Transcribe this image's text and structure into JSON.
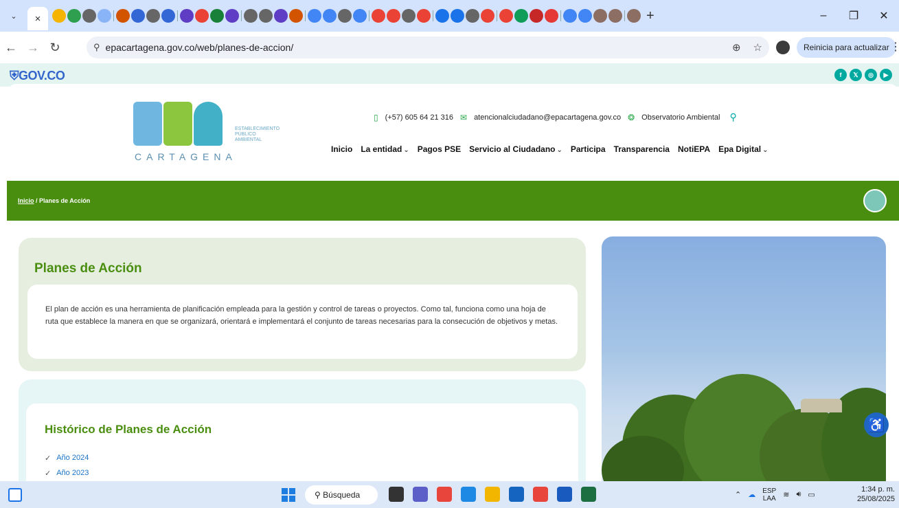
{
  "browser": {
    "url": "epacartagena.gov.co/web/planes-de-accion/",
    "update_button": "Reinicia para actualizar",
    "new_tab": "+",
    "tab_colors": [
      "#f4b400",
      "#2e9e4f",
      "#666666",
      "#8ab4f8",
      "#d35400",
      "#3367d6",
      "#666666",
      "#3367d6",
      "#5f3dc4",
      "#ea4335",
      "#188038",
      "#5f3dc4",
      "#666666",
      "#666666",
      "#5f3dc4",
      "#d35400",
      "#4285f4",
      "#4285f4",
      "#666666",
      "#4285f4",
      "#ea4335",
      "#ea4335",
      "#666666",
      "#ea4335",
      "#1a73e8",
      "#1a73e8",
      "#666666",
      "#ea4335",
      "#ea4335",
      "#0f9d58",
      "#c62828",
      "#e53935",
      "#4285f4",
      "#4285f4",
      "#8d6e63",
      "#8d6e63",
      "#8d6e63"
    ]
  },
  "gov": {
    "logo": "GOV.CO",
    "social_icons": [
      "facebook-icon",
      "x-icon",
      "instagram-icon",
      "youtube-icon"
    ],
    "social_glyphs": [
      "f",
      "𝕏",
      "◎",
      "▶"
    ]
  },
  "header": {
    "logo_sub": [
      "ESTABLECIMIENTO",
      "PÚBLICO",
      "AMBIENTAL"
    ],
    "logo_city": "CARTAGENA",
    "phone": "(+57) 605 64 21 316",
    "email": "atencionalciudadano@epacartagena.gov.co",
    "observatorio": "Observatorio Ambiental",
    "nav": [
      {
        "label": "Inicio",
        "dropdown": false
      },
      {
        "label": "La entidad",
        "dropdown": true
      },
      {
        "label": "Pagos PSE",
        "dropdown": false
      },
      {
        "label": "Servicio al Ciudadano",
        "dropdown": true
      },
      {
        "label": "Participa",
        "dropdown": false
      },
      {
        "label": "Transparencia",
        "dropdown": false
      },
      {
        "label": "NotiEPA",
        "dropdown": false
      },
      {
        "label": "Epa Digital",
        "dropdown": true
      }
    ]
  },
  "breadcrumb": {
    "home": "Inicio",
    "separator": " / ",
    "current": "Planes de Acción"
  },
  "intro": {
    "title": "Planes de Acción",
    "body": "El plan de acción es una herramienta de planificación empleada para la gestión y control de tareas o proyectos. Como tal, funciona como una hoja de ruta que establece la manera en que se organizará, orientará e implementará el conjunto de tareas necesarias para la consecución de objetivos y metas."
  },
  "history": {
    "title": "Histórico de Planes de Acción",
    "items": [
      "Año 2024",
      "Año 2023"
    ]
  },
  "taskbar": {
    "search": "Búsqueda",
    "app_colors": [
      "#333333",
      "#5b5fc7",
      "#e8453c",
      "#1e88e5",
      "#f2b600",
      "#1565c0",
      "#e8453c",
      "#185abd",
      "#1d6f42"
    ],
    "lang": "ESP",
    "lang_sub": "LAA",
    "time": "1:34 p. m.",
    "date": "25/08/2025"
  },
  "colors": {
    "brand_green": "#4a8e10",
    "link_blue": "#1a73c6",
    "a11y_blue": "#1f66c2"
  }
}
